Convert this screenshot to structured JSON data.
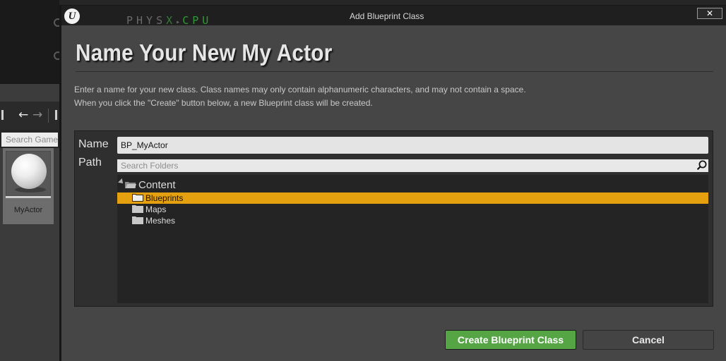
{
  "background": {
    "search_placeholder": "Search Game",
    "asset_name": "MyActor"
  },
  "dialog": {
    "window_title": "Add Blueprint Class",
    "close_glyph": "✕",
    "physx_brand": {
      "left": "PHYS",
      "x": "X",
      "arrow": "▸",
      "right": "CPU"
    },
    "heading": "Name Your New My Actor",
    "description_line1": "Enter a name for your new class. Class names may only contain alphanumeric characters, and may not contain a space.",
    "description_line2": "When you click the \"Create\" button below, a new Blueprint class will be created.",
    "name_label": "Name",
    "name_value": "BP_MyActor",
    "path_label": "Path",
    "search_placeholder": "Search Folders",
    "folders": [
      {
        "label": "Content",
        "expanded": true,
        "selected": false
      },
      {
        "label": "Blueprints",
        "selected": true
      },
      {
        "label": "Maps",
        "selected": false
      },
      {
        "label": "Meshes",
        "selected": false
      }
    ],
    "create_button": "Create Blueprint Class",
    "cancel_button": "Cancel"
  },
  "colors": {
    "selection": "#e4a00e",
    "create_button": "#56a545",
    "physx_green": "#2f9a33"
  },
  "icons": [
    "unreal-logo-icon",
    "close-icon",
    "search-icon",
    "folder-icon",
    "expand-caret-icon",
    "back-arrow-icon",
    "forward-arrow-icon"
  ]
}
